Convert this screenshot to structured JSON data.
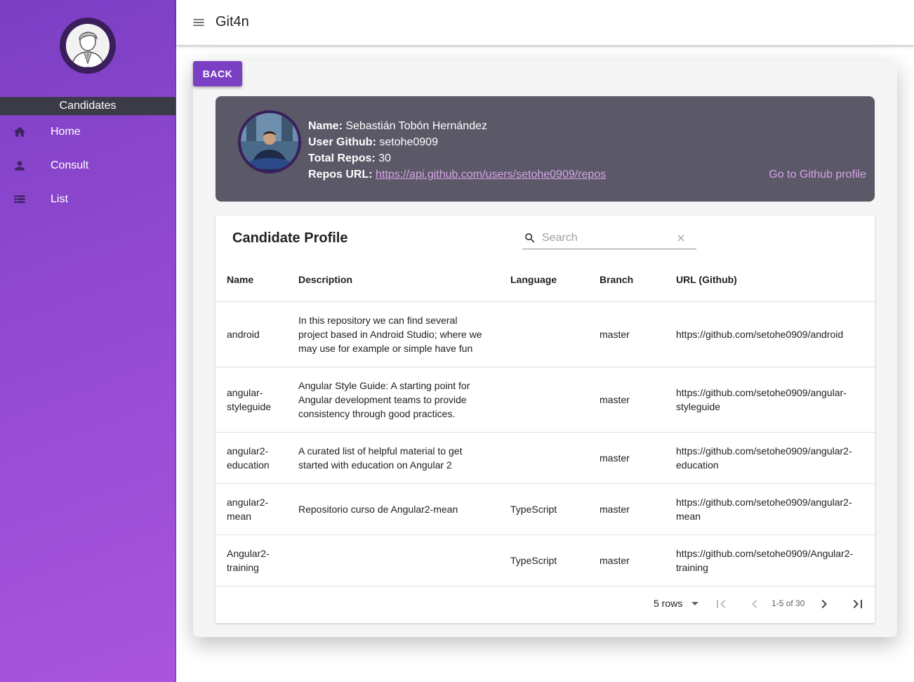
{
  "app": {
    "title": "Git4n"
  },
  "sidebar": {
    "header": "Candidates",
    "items": [
      {
        "label": "Home",
        "icon": "home-icon"
      },
      {
        "label": "Consult",
        "icon": "person-icon"
      },
      {
        "label": "List",
        "icon": "list-icon"
      }
    ]
  },
  "main": {
    "back_label": "BACK",
    "profile": {
      "name_label": "Name:",
      "name_value": "Sebastián Tobón Hernández",
      "github_label": "User Github:",
      "github_value": "setohe0909",
      "repos_label": "Total Repos:",
      "repos_value": "30",
      "url_label": "Repos URL:",
      "url_value": "https://api.github.com/users/setohe0909/repos",
      "go_profile": "Go to Github profile"
    },
    "table": {
      "title": "Candidate Profile",
      "search_placeholder": "Search",
      "columns": [
        "Name",
        "Description",
        "Language",
        "Branch",
        "URL (Github)"
      ],
      "rows": [
        {
          "name": "android",
          "description": "In this repository we can find several project based in Android Studio; where we may use for example or simple have fun",
          "language": "",
          "branch": "master",
          "url": "https://github.com/setohe0909/android"
        },
        {
          "name": "angular-styleguide",
          "description": "Angular Style Guide: A starting point for Angular development teams to provide consistency through good practices.",
          "language": "",
          "branch": "master",
          "url": "https://github.com/setohe0909/angular-styleguide"
        },
        {
          "name": "angular2-education",
          "description": "A curated list of helpful material to get started with education on Angular 2",
          "language": "",
          "branch": "master",
          "url": "https://github.com/setohe0909/angular2-education"
        },
        {
          "name": "angular2-mean",
          "description": "Repositorio curso de Angular2-mean",
          "language": "TypeScript",
          "branch": "master",
          "url": "https://github.com/setohe0909/angular2-mean"
        },
        {
          "name": "Angular2-training",
          "description": "",
          "language": "TypeScript",
          "branch": "master",
          "url": "https://github.com/setohe0909/Angular2-training"
        }
      ],
      "pagination": {
        "rows_per_page": "5 rows",
        "range": "1-5 of 30"
      }
    }
  },
  "colors": {
    "accent": "#7b3fc4",
    "profile_bg": "#5b5867",
    "link": "#d6a5e9"
  }
}
